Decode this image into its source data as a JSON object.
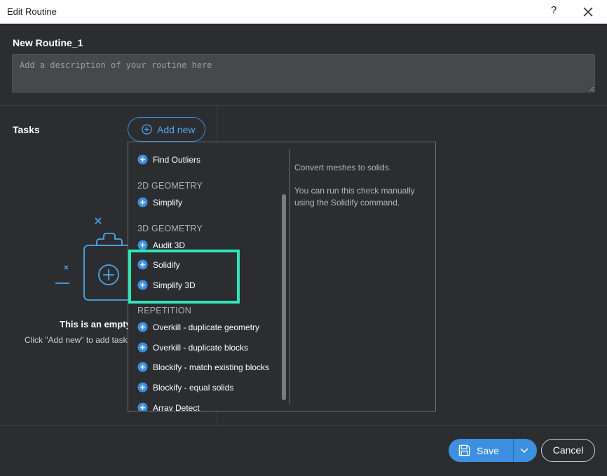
{
  "window": {
    "title": "Edit Routine",
    "help_label": "?"
  },
  "routine": {
    "name": "New Routine_1",
    "description_placeholder": "Add a description of your routine here",
    "description_value": ""
  },
  "tasks": {
    "label": "Tasks",
    "add_new_label": "Add new",
    "empty_title": "This is an empty",
    "empty_subtitle": "Click \"Add new\" to add task"
  },
  "dropdown": {
    "items": [
      {
        "type": "task",
        "label": "Find Outliers"
      },
      {
        "type": "category",
        "label": "2D GEOMETRY"
      },
      {
        "type": "task",
        "label": "Simplify"
      },
      {
        "type": "category",
        "label": "3D GEOMETRY"
      },
      {
        "type": "task",
        "label": "Audit 3D"
      },
      {
        "type": "task",
        "label": "Solidify"
      },
      {
        "type": "task",
        "label": "Simplify 3D"
      },
      {
        "type": "category",
        "label": "REPETITION"
      },
      {
        "type": "task",
        "label": "Overkill - duplicate geometry"
      },
      {
        "type": "task",
        "label": "Overkill - duplicate blocks"
      },
      {
        "type": "task",
        "label": "Blockify - match existing blocks"
      },
      {
        "type": "task",
        "label": "Blockify - equal solids"
      },
      {
        "type": "task",
        "label": "Array Detect"
      }
    ],
    "info": {
      "line1": "Convert meshes to solids.",
      "line2": "You can run this check manually using the Solidify command."
    }
  },
  "footer": {
    "save_label": "Save",
    "cancel_label": "Cancel"
  },
  "colors": {
    "accent": "#3d8fe0",
    "highlight": "#2ee6b8",
    "background": "#2b2d30"
  }
}
